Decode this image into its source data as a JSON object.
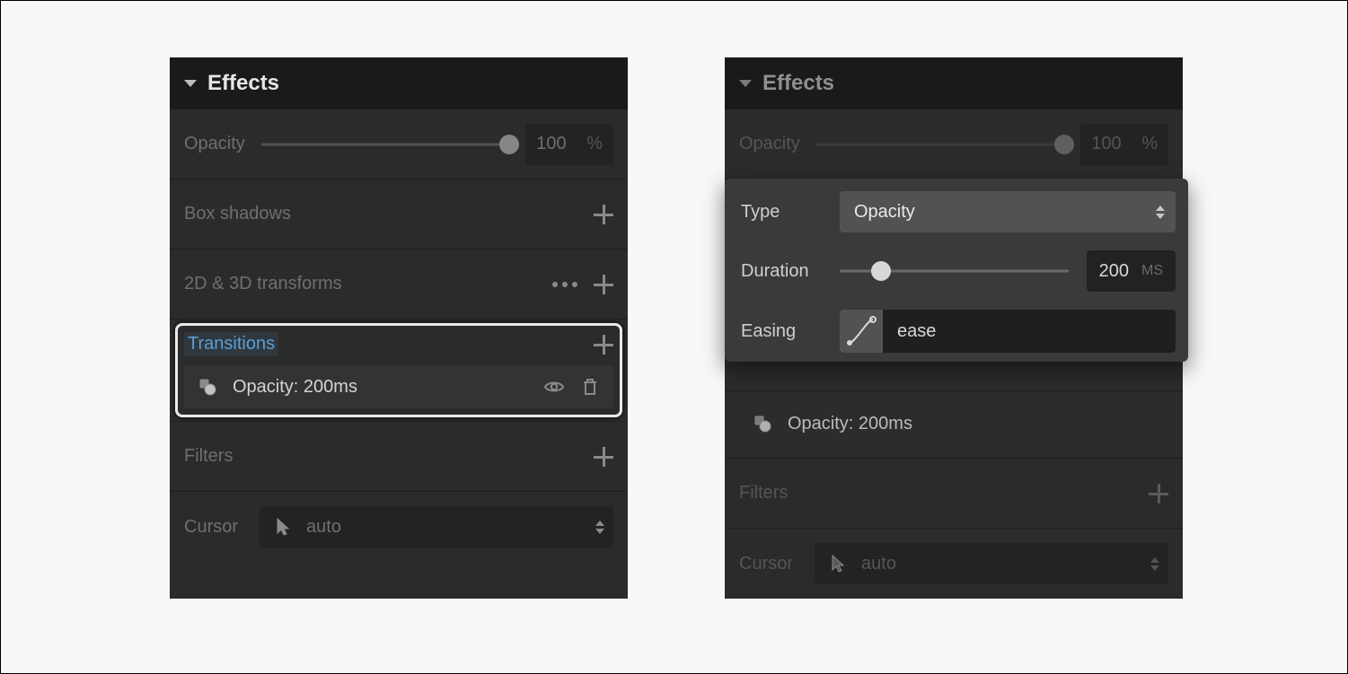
{
  "left": {
    "header": "Effects",
    "opacity": {
      "label": "Opacity",
      "value": "100",
      "unit": "%"
    },
    "box_shadows": {
      "label": "Box shadows"
    },
    "transforms": {
      "label": "2D & 3D transforms"
    },
    "transitions": {
      "label": "Transitions",
      "item": "Opacity: 200ms"
    },
    "filters": {
      "label": "Filters"
    },
    "cursor": {
      "label": "Cursor",
      "value": "auto"
    }
  },
  "right": {
    "header": "Effects",
    "opacity": {
      "label": "Opacity",
      "value": "100",
      "unit": "%"
    },
    "popup": {
      "type_label": "Type",
      "type_value": "Opacity",
      "duration_label": "Duration",
      "duration_value": "200",
      "duration_unit": "MS",
      "easing_label": "Easing",
      "easing_value": "ease"
    },
    "transitions": {
      "item": "Opacity: 200ms"
    },
    "filters": {
      "label": "Filters"
    },
    "cursor": {
      "label": "Cursor",
      "value": "auto"
    }
  }
}
